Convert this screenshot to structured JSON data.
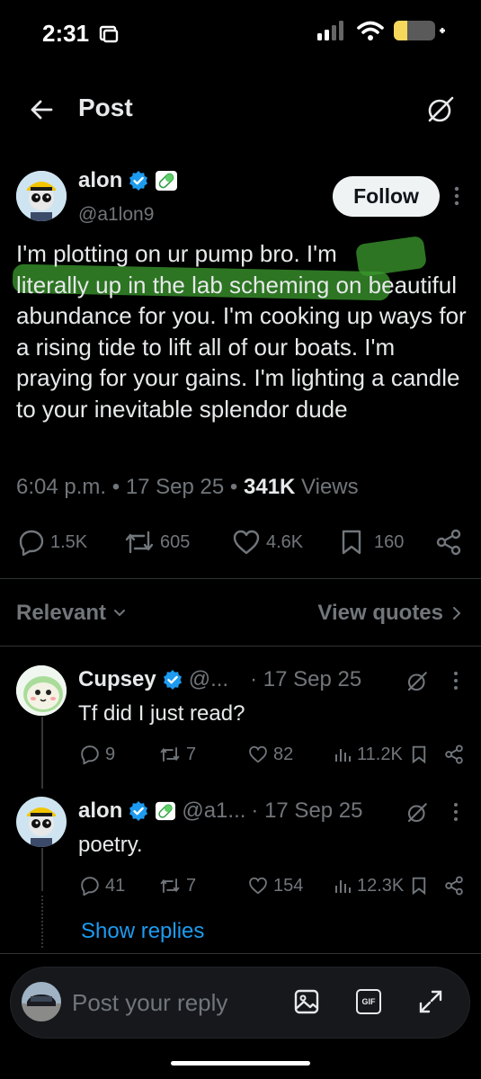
{
  "status_bar": {
    "time": "2:31",
    "battery_color": "#f5d85b"
  },
  "header": {
    "title": "Post",
    "back_icon": "arrow-left-icon",
    "grok_icon": "slashed-circle-icon"
  },
  "post": {
    "author_name": "alon",
    "author_handle": "@a1lon9",
    "verified": true,
    "follow_label": "Follow",
    "text_before": "I'm plotting on ur pump bro. ",
    "text_highlight_1": "I'm",
    "text_highlight_2": "literally up in the lab scheming",
    "text_after": " on beautiful abundance for you. I'm cooking up ways for a rising tide to lift all of our boats. I'm praying for your gains. I'm lighting a candle to your inevitable splendor dude",
    "time": "6:04 p.m.",
    "date": "17 Sep 25",
    "views_count": "341K",
    "views_label": "Views",
    "sep": "•",
    "replies": "1.5K",
    "reposts": "605",
    "likes": "4.6K",
    "bookmarks": "160",
    "highlight_color": "#3a962d"
  },
  "filters": {
    "relevant_label": "Relevant",
    "view_quotes_label": "View quotes"
  },
  "replies": [
    {
      "name": "Cupsey",
      "handle": "@...",
      "date": "· 17 Sep 25",
      "text": "Tf did I just read?",
      "replies": "9",
      "reposts": "7",
      "likes": "82",
      "views": "11.2K"
    },
    {
      "name": "alon",
      "handle": "@a1...",
      "date": "· 17 Sep 25",
      "text": "poetry.",
      "replies": "41",
      "reposts": "7",
      "likes": "154",
      "views": "12.3K"
    }
  ],
  "show_replies_label": "Show replies",
  "composer": {
    "placeholder": "Post your reply",
    "gif_label": "GIF"
  },
  "colors": {
    "accent": "#1d9bf0",
    "muted": "#71767b",
    "text": "#e7e9ea",
    "background": "#000000",
    "verified": "#1d9bf0"
  }
}
